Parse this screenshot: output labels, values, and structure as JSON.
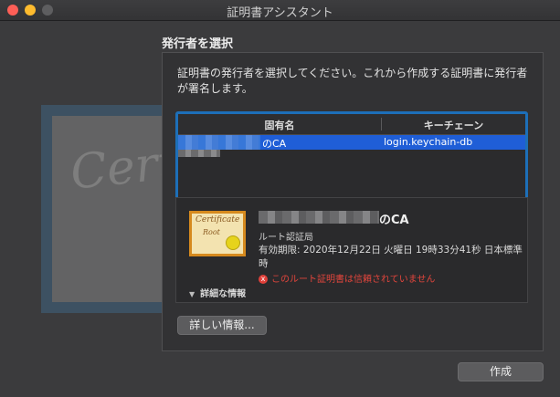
{
  "window": {
    "title": "証明書アシスタント"
  },
  "background_icon": {
    "script_text": "Certif"
  },
  "page": {
    "heading": "発行者を選択",
    "description": "証明書の発行者を選択してください。これから作成する証明書に発行者が署名します。"
  },
  "table": {
    "columns": [
      "固有名",
      "キーチェーン"
    ],
    "rows": [
      {
        "name_suffix": "のCA",
        "keychain": "login.keychain-db",
        "selected": true
      }
    ]
  },
  "detail": {
    "icon_text_1": "Certificate",
    "icon_text_2": "Root",
    "name_suffix": "のCA",
    "subtitle": "ルート認証局",
    "expiry": "有効期限: 2020年12月22日 火曜日 19時33分41秒 日本標準時",
    "warning": "このルート証明書は信頼されていません",
    "warning_icon": "x",
    "disclosure": "詳細な情報"
  },
  "buttons": {
    "more_info": "詳しい情報...",
    "create": "作成"
  },
  "colors": {
    "selection": "#1f5ed7",
    "focus_ring": "#1d6fb8",
    "warning": "#e2453c"
  }
}
